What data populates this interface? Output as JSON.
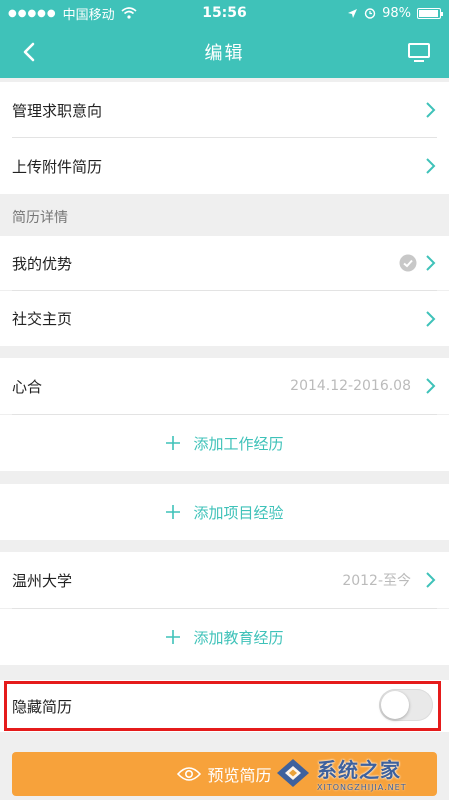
{
  "status_bar": {
    "carrier": "中国移动",
    "time": "15:56",
    "battery": "98%"
  },
  "nav": {
    "title": "编辑"
  },
  "rows": {
    "job_intention": "管理求职意向",
    "upload_attachment": "上传附件简历"
  },
  "resume_details": {
    "section_title": "简历详情",
    "my_advantage": "我的优势",
    "social_homepage": "社交主页"
  },
  "work": {
    "company": "心合",
    "period": "2014.12-2016.08",
    "add_label": "添加工作经历"
  },
  "project": {
    "add_label": "添加项目经验"
  },
  "education": {
    "school": "温州大学",
    "period": "2012-至今",
    "add_label": "添加教育经历"
  },
  "hide_resume": {
    "label": "隐藏简历",
    "enabled": false
  },
  "preview": {
    "label": "预览简历"
  },
  "watermark": {
    "main": "系统之家",
    "sub": "XITONGZHIJIA.NET"
  },
  "colors": {
    "accent": "#3fc2b9",
    "orange": "#f7a23b",
    "highlight": "#e51b1b"
  }
}
